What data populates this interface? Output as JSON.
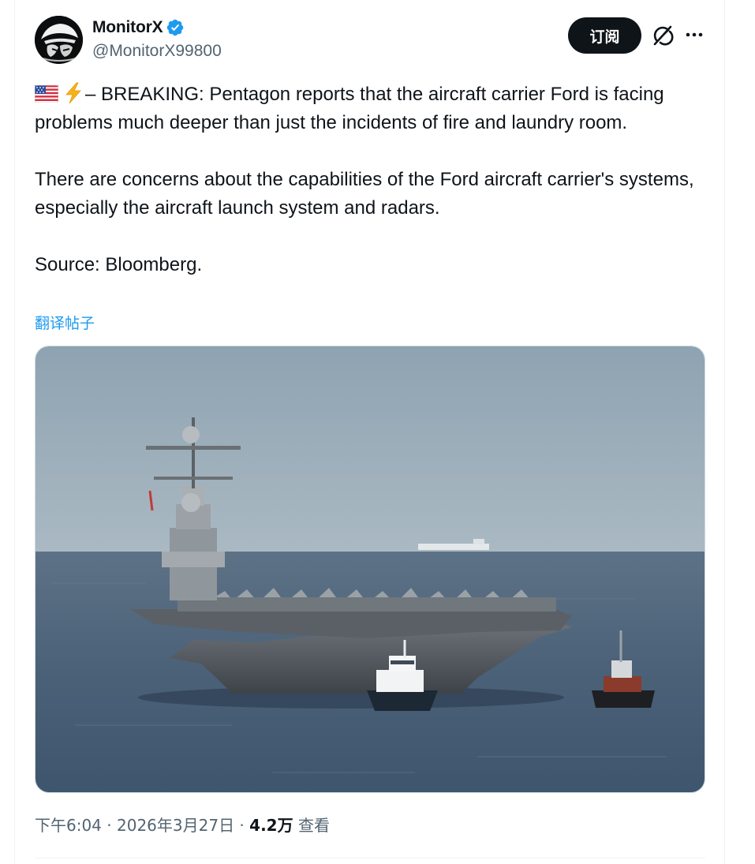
{
  "author": {
    "display_name": "MonitorX",
    "handle": "@MonitorX99800",
    "verified_icon": "verified-badge-icon",
    "verified_color": "#1d9bf0"
  },
  "header_actions": {
    "subscribe_label": "订阅",
    "grok_icon": "grok-icon",
    "more_icon": "more-icon"
  },
  "tweet": {
    "prefix_icons": [
      "us-flag-emoji",
      "lightning-emoji"
    ],
    "paragraph1": "– BREAKING: Pentagon reports that the aircraft carrier Ford is facing problems much deeper than just the incidents of fire and laundry room.",
    "paragraph2": "There are concerns about the capabilities of the Ford aircraft carrier's systems, especially the aircraft launch system and radars.",
    "paragraph3": "Source: Bloomberg.",
    "translate_label": "翻译帖子"
  },
  "media": {
    "description_icon": "aircraft-carrier-photo"
  },
  "meta": {
    "time": "下午6:04",
    "separator1": " · ",
    "date": "2026年3月27日",
    "separator2": " · ",
    "views_count": "4.2万",
    "views_label": " 查看"
  },
  "colors": {
    "text_primary": "#0f1419",
    "text_secondary": "#536471",
    "link": "#1d9bf0",
    "button_bg": "#0f1419"
  }
}
